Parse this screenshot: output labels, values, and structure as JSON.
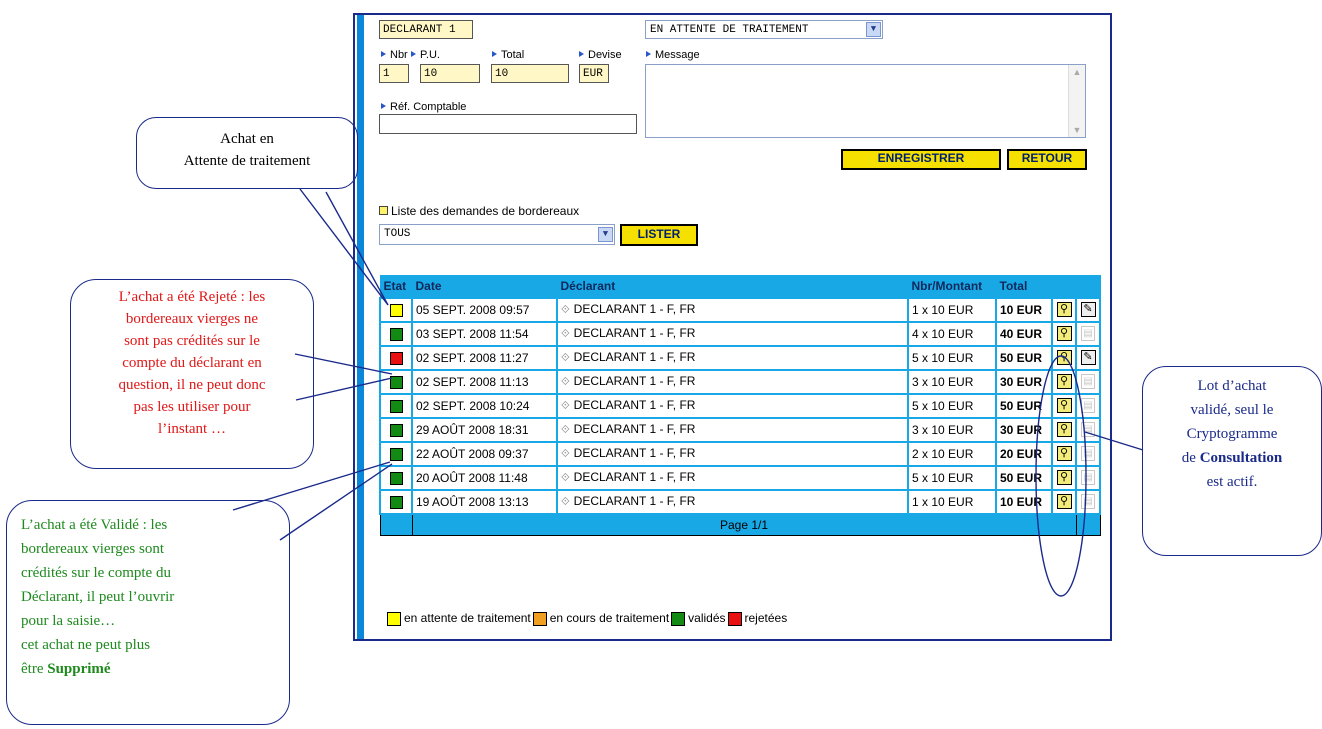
{
  "form": {
    "declarant_value": "DECLARANT 1",
    "status_select": "EN ATTENTE DE TRAITEMENT",
    "nbr_label": "Nbr",
    "pu_label": "P.U.",
    "total_label": "Total",
    "devise_label": "Devise",
    "message_label": "Message",
    "nbr_value": "1",
    "pu_value": "10",
    "total_value": "10",
    "devise_value": "EUR",
    "ref_label": "Réf. Comptable",
    "ref_value": "",
    "message_value": "",
    "save_button": "ENREGISTRER",
    "back_button": "RETOUR"
  },
  "list": {
    "title": "Liste des demandes de bordereaux",
    "filter_value": "TOUS",
    "list_button": "LISTER"
  },
  "table": {
    "headers": [
      "Etat",
      "Date",
      "Déclarant",
      "Nbr/Montant",
      "Total"
    ],
    "rows": [
      {
        "status_color": "#ffff00",
        "date": "05 SEPT. 2008 09:57",
        "declarant": "DECLARANT 1 - F, FR",
        "nbr": "1 x 10 EUR",
        "total": "10 EUR",
        "edit_active": true
      },
      {
        "status_color": "#138a13",
        "date": "03 SEPT. 2008 11:54",
        "declarant": "DECLARANT 1 - F, FR",
        "nbr": "4 x 10 EUR",
        "total": "40 EUR",
        "edit_active": false
      },
      {
        "status_color": "#e81010",
        "date": "02 SEPT. 2008 11:27",
        "declarant": "DECLARANT 1 - F, FR",
        "nbr": "5 x 10 EUR",
        "total": "50 EUR",
        "edit_active": true
      },
      {
        "status_color": "#138a13",
        "date": "02 SEPT. 2008 11:13",
        "declarant": "DECLARANT 1 - F, FR",
        "nbr": "3 x 10 EUR",
        "total": "30 EUR",
        "edit_active": false
      },
      {
        "status_color": "#138a13",
        "date": "02 SEPT. 2008 10:24",
        "declarant": "DECLARANT 1 - F, FR",
        "nbr": "5 x 10 EUR",
        "total": "50 EUR",
        "edit_active": false
      },
      {
        "status_color": "#138a13",
        "date": "29 AOÛT 2008 18:31",
        "declarant": "DECLARANT 1 - F, FR",
        "nbr": "3 x 10 EUR",
        "total": "30 EUR",
        "edit_active": false
      },
      {
        "status_color": "#138a13",
        "date": "22 AOÛT 2008 09:37",
        "declarant": "DECLARANT 1 - F, FR",
        "nbr": "2 x 10 EUR",
        "total": "20 EUR",
        "edit_active": false
      },
      {
        "status_color": "#138a13",
        "date": "20 AOÛT 2008 11:48",
        "declarant": "DECLARANT 1 - F, FR",
        "nbr": "5 x 10 EUR",
        "total": "50 EUR",
        "edit_active": false
      },
      {
        "status_color": "#138a13",
        "date": "19 AOÛT 2008 13:13",
        "declarant": "DECLARANT 1 - F, FR",
        "nbr": "1 x 10 EUR",
        "total": "10 EUR",
        "edit_active": false
      }
    ],
    "pagination": "Page 1/1"
  },
  "legend": [
    {
      "color": "#ffff00",
      "label": "en attente de traitement"
    },
    {
      "color": "#f0a020",
      "label": "en cours de traitement"
    },
    {
      "color": "#138a13",
      "label": "validés"
    },
    {
      "color": "#e81010",
      "label": "rejetées"
    }
  ],
  "callouts": {
    "attente_line1": "Achat en",
    "attente_line2": "Attente de traitement",
    "rejete_l1": "L’achat a été Rejeté : les",
    "rejete_l2": "bordereaux vierges ne",
    "rejete_l3": "sont pas crédités sur le",
    "rejete_l4": "compte du déclarant en",
    "rejete_l5": "question, il ne peut donc",
    "rejete_l6": "pas les utiliser pour",
    "rejete_l7": "l’instant …",
    "valide_l1": "L’achat a été Validé : les",
    "valide_l2": "bordereaux vierges sont",
    "valide_l3": "crédités sur le compte du",
    "valide_l4": "Déclarant, il peut l’ouvrir",
    "valide_l5": "pour la saisie…",
    "valide_l6": "cet achat ne peut plus",
    "valide_l7_pre": "être",
    "valide_l7_bold": "Supprimé",
    "lot_l1": "Lot d’achat",
    "lot_l2": "validé, seul le",
    "lot_l3": "Cryptogramme",
    "lot_l4_pre": "de",
    "lot_l4_bold": "Consultation",
    "lot_l5": "est actif."
  }
}
